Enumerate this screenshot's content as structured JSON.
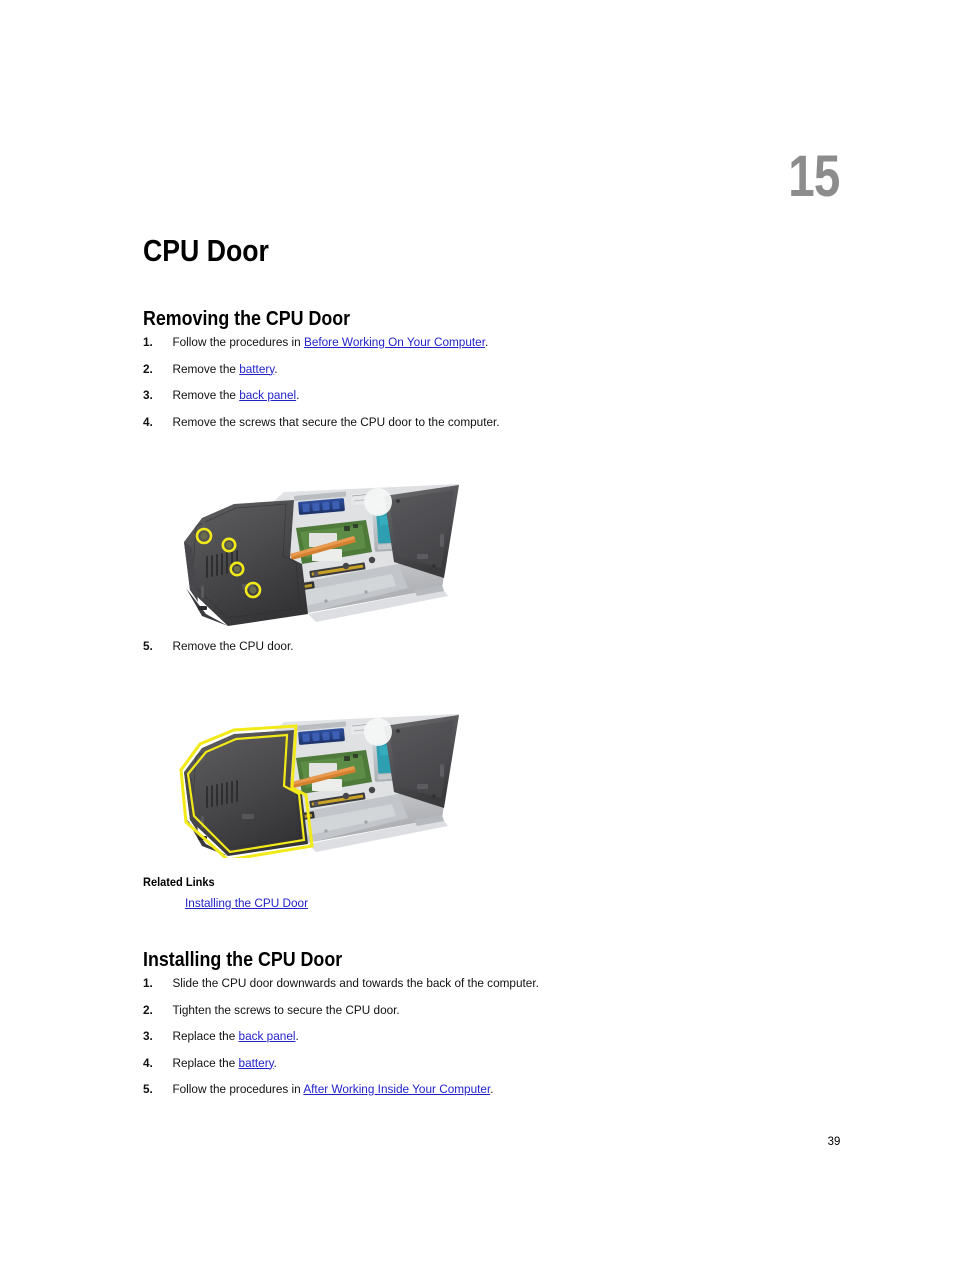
{
  "document": {
    "chapter_number": "15",
    "chapter_title": "CPU Door",
    "page_number": "39"
  },
  "sections": [
    {
      "id": "removing",
      "heading": "Removing the CPU Door",
      "steps": [
        {
          "num": "1.",
          "pre": "Follow the procedures in ",
          "link": "Before Working On Your Computer",
          "post": "."
        },
        {
          "num": "2.",
          "pre": "Remove the ",
          "link": "battery",
          "post": "."
        },
        {
          "num": "3.",
          "pre": "Remove the ",
          "link": "back panel",
          "post": "."
        },
        {
          "num": "4.",
          "pre": "Remove the screws that secure the CPU door to the computer.",
          "link": "",
          "post": ""
        },
        {
          "num": "5.",
          "pre": "Remove the CPU door.",
          "link": "",
          "post": ""
        }
      ]
    },
    {
      "id": "installing",
      "heading": "Installing the CPU Door",
      "steps": [
        {
          "num": "1.",
          "pre": "Slide the CPU door downwards and towards the back of the computer.",
          "link": "",
          "post": ""
        },
        {
          "num": "2.",
          "pre": "Tighten the screws to secure the CPU door.",
          "link": "",
          "post": ""
        },
        {
          "num": "3.",
          "pre": "Replace the ",
          "link": "back panel",
          "post": "."
        },
        {
          "num": "4.",
          "pre": "Replace the ",
          "link": "battery",
          "post": "."
        },
        {
          "num": "5.",
          "pre": "Follow the procedures in ",
          "link": "After Working Inside Your Computer",
          "post": "."
        }
      ]
    }
  ],
  "related_links": {
    "title": "Related Links",
    "items": [
      "Installing the CPU Door"
    ]
  },
  "figures": [
    {
      "id": "figure-screws",
      "caption": "Bottom view of laptop with four screw locations highlighted",
      "highlight_color": "#f2ea18",
      "highlight_type": "circles",
      "highlight_count": 4
    },
    {
      "id": "figure-door",
      "caption": "Bottom view of laptop with CPU door region outlined",
      "highlight_color": "#f2ea18",
      "highlight_type": "outline",
      "highlight_count": 1
    }
  ],
  "colors": {
    "link": "#2222cc",
    "chapter_number": "#8c8c8c",
    "text": "#111111",
    "highlight": "#f2ea18"
  }
}
